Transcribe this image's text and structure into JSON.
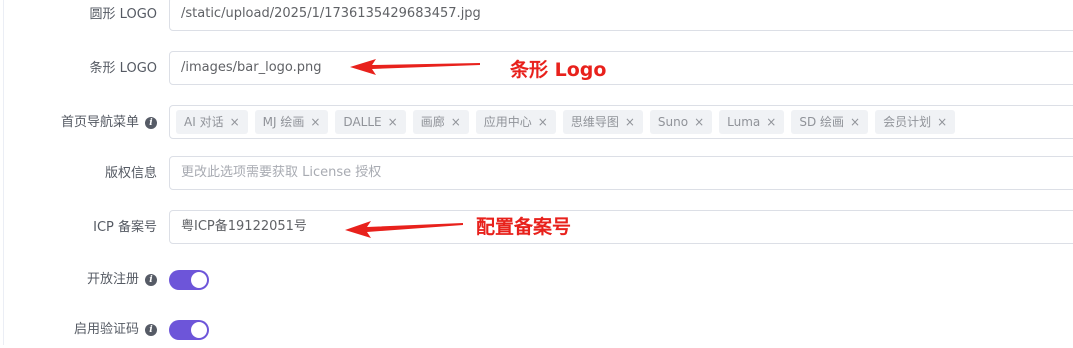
{
  "form": {
    "round_logo": {
      "label": "圆形 LOGO",
      "value": "/static/upload/2025/1/1736135429683457.jpg"
    },
    "bar_logo": {
      "label": "条形 LOGO",
      "value": "/images/bar_logo.png"
    },
    "nav_menu": {
      "label": "首页导航菜单",
      "tags": [
        "AI 对话",
        "MJ 绘画",
        "DALLE",
        "画廊",
        "应用中心",
        "思维导图",
        "Suno",
        "Luma",
        "SD 绘画",
        "会员计划"
      ]
    },
    "copyright": {
      "label": "版权信息",
      "placeholder": "更改此选项需要获取 License 授权"
    },
    "icp": {
      "label": "ICP 备案号",
      "value": "粤ICP备19122051号"
    },
    "open_register": {
      "label": "开放注册",
      "enabled": true
    },
    "enable_captcha": {
      "label": "启用验证码",
      "enabled": true
    }
  },
  "annotations": {
    "bar_logo_note": "条形 Logo",
    "icp_note": "配置备案号"
  },
  "colors": {
    "accent": "#6d55d9",
    "annotation": "#e8211c"
  }
}
